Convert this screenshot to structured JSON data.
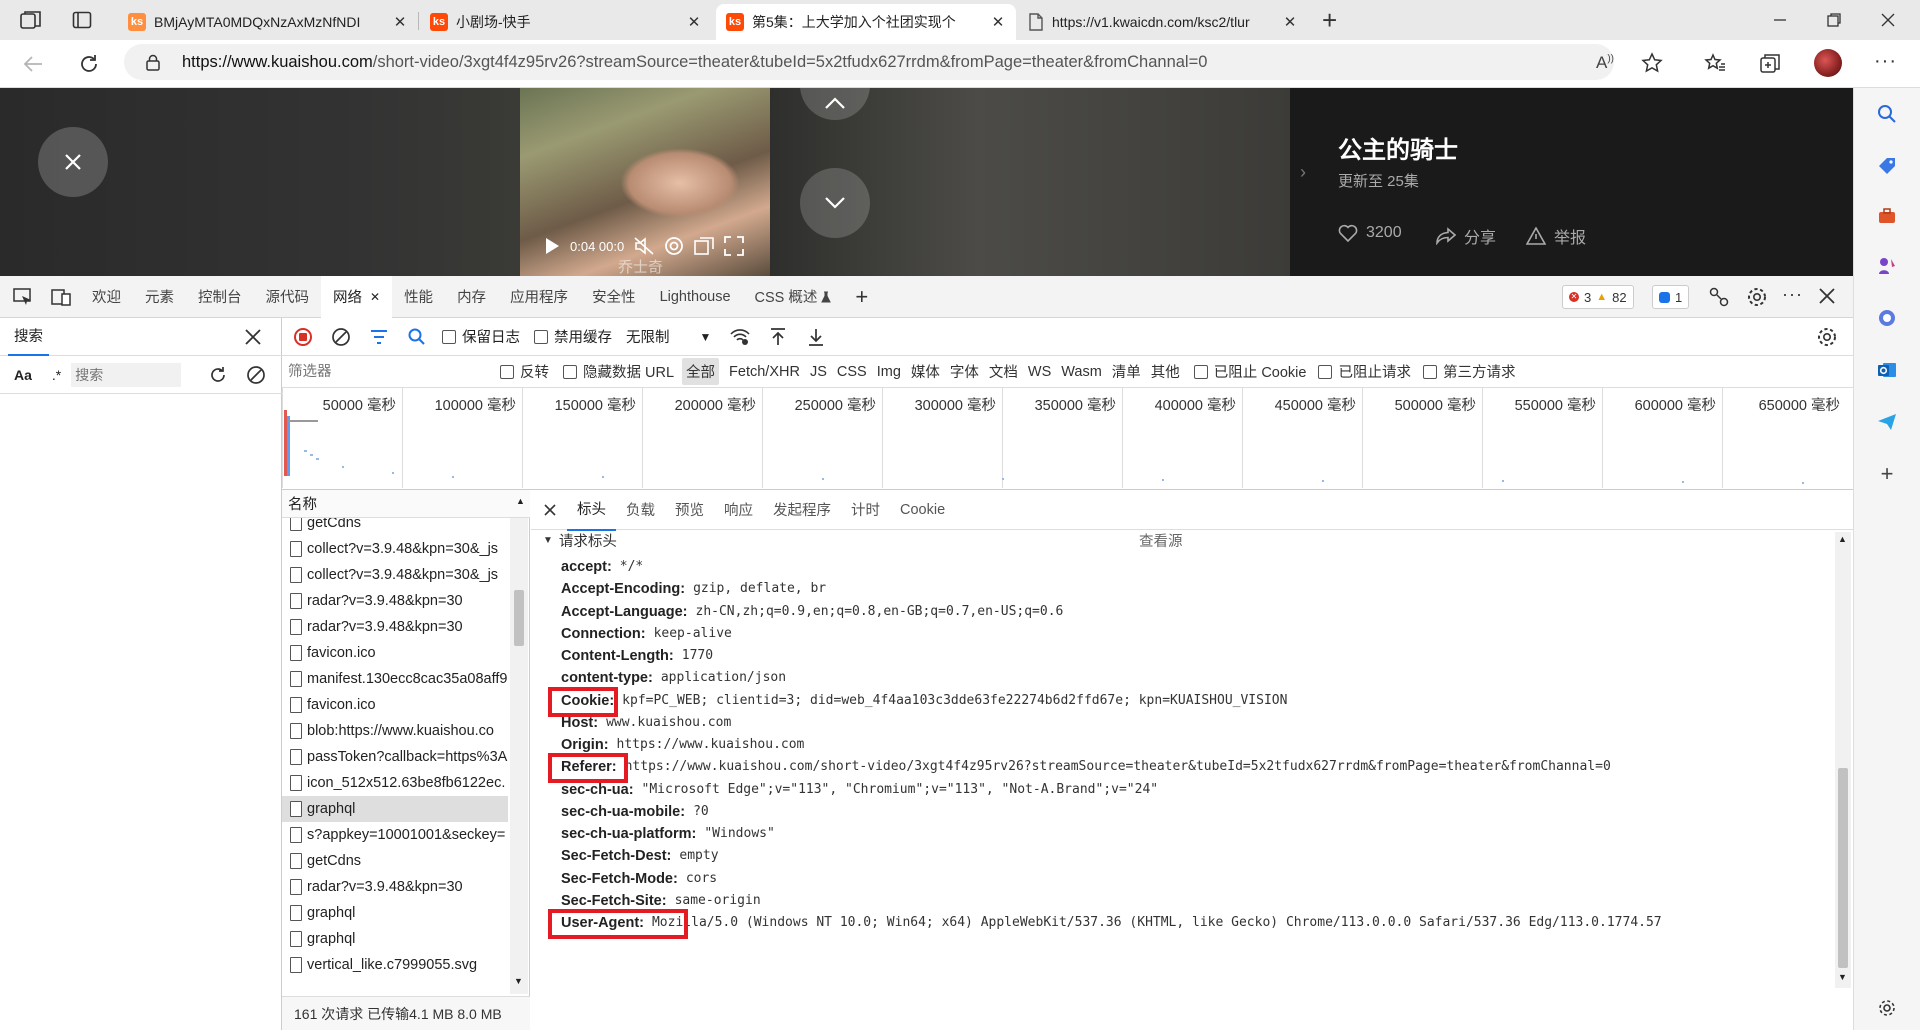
{
  "browser": {
    "tabs": [
      {
        "title": "BMjAyMTA0MDQxNzAxMzNfNDI",
        "icon": "kuaishou-favicon",
        "color": "#ff8f3f"
      },
      {
        "title": "小剧场-快手",
        "icon": "kuaishou-favicon",
        "color": "#ff4906"
      },
      {
        "title": "第5集：上大学加入个社团实现个",
        "icon": "kuaishou-favicon",
        "color": "#ff4906"
      },
      {
        "title": "https://v1.kwaicdn.com/ksc2/tlur",
        "icon": "page-icon"
      }
    ],
    "url_host": "https://www.kuaishou.com",
    "url_path": "/short-video/3xgt4f4z95rv26?streamSource=theater&tubeId=5x2tfudx627rrdm&fromPage=theater&fromChannal=0"
  },
  "player": {
    "series_title": "公主的骑士",
    "episodes_label": "更新至 25集",
    "likes": "3200",
    "share_label": "分享",
    "report_label": "举报",
    "time": "0:04 00:0",
    "caption": "乔士奇"
  },
  "devtools": {
    "tabs": [
      "欢迎",
      "元素",
      "控制台",
      "源代码",
      "网络",
      "性能",
      "内存",
      "应用程序",
      "安全性",
      "Lighthouse",
      "CSS 概述"
    ],
    "active_tab": "网络",
    "errors": "3",
    "warnings": "82",
    "messages": "1",
    "search": {
      "title": "搜索",
      "case_label": "Aa",
      "regex_label": ".*",
      "placeholder": "搜索"
    },
    "toolbar": {
      "preserve_log": "保留日志",
      "disable_cache": "禁用缓存",
      "throttle": "无限制"
    },
    "filter": {
      "placeholder": "筛选器",
      "invert": "反转",
      "hide_data_urls": "隐藏数据 URL",
      "types": [
        "全部",
        "Fetch/XHR",
        "JS",
        "CSS",
        "Img",
        "媒体",
        "字体",
        "文档",
        "WS",
        "Wasm",
        "清单",
        "其他"
      ],
      "blocked_cookies": "已阻止 Cookie",
      "blocked_requests": "已阻止请求",
      "third_party": "第三方请求"
    },
    "timeline_ticks": [
      "50000 毫秒",
      "100000 毫秒",
      "150000 毫秒",
      "200000 毫秒",
      "250000 毫秒",
      "300000 毫秒",
      "350000 毫秒",
      "400000 毫秒",
      "450000 毫秒",
      "500000 毫秒",
      "550000 毫秒",
      "600000 毫秒",
      "650000 毫秒"
    ],
    "request_list": {
      "header": "名称",
      "items": [
        "getCdns",
        "collect?v=3.9.48&kpn=30&_js",
        "collect?v=3.9.48&kpn=30&_js",
        "radar?v=3.9.48&kpn=30",
        "radar?v=3.9.48&kpn=30",
        "favicon.ico",
        "manifest.130ecc8cac35a08aff9",
        "favicon.ico",
        "blob:https://www.kuaishou.co",
        "passToken?callback=https%3A",
        "icon_512x512.63be8fb6122ec.",
        "graphql",
        "s?appkey=10001001&seckey=",
        "getCdns",
        "radar?v=3.9.48&kpn=30",
        "graphql",
        "graphql",
        "vertical_like.c7999055.svg"
      ],
      "selected_index": 11,
      "status": "161 次请求  已传输4.1 MB  8.0 MB"
    },
    "detail_tabs": [
      "标头",
      "负载",
      "预览",
      "响应",
      "发起程序",
      "计时",
      "Cookie"
    ],
    "section_title": "请求标头",
    "view_source": "查看源",
    "headers": [
      {
        "name": "accept:",
        "value": "*/*"
      },
      {
        "name": "Accept-Encoding:",
        "value": "gzip, deflate, br"
      },
      {
        "name": "Accept-Language:",
        "value": "zh-CN,zh;q=0.9,en;q=0.8,en-GB;q=0.7,en-US;q=0.6"
      },
      {
        "name": "Connection:",
        "value": "keep-alive"
      },
      {
        "name": "Content-Length:",
        "value": "1770"
      },
      {
        "name": "content-type:",
        "value": "application/json"
      },
      {
        "name": "Cookie:",
        "value": "kpf=PC_WEB; clientid=3; did=web_4f4aa103c3dde63fe22274b6d2ffd67e; kpn=KUAISHOU_VISION"
      },
      {
        "name": "Host:",
        "value": "www.kuaishou.com"
      },
      {
        "name": "Origin:",
        "value": "https://www.kuaishou.com"
      },
      {
        "name": "Referer:",
        "value": "https://www.kuaishou.com/short-video/3xgt4f4z95rv26?streamSource=theater&tubeId=5x2tfudx627rrdm&fromPage=theater&fromChannal=0"
      },
      {
        "name": "sec-ch-ua:",
        "value": "\"Microsoft Edge\";v=\"113\", \"Chromium\";v=\"113\", \"Not-A.Brand\";v=\"24\""
      },
      {
        "name": "sec-ch-ua-mobile:",
        "value": "?0"
      },
      {
        "name": "sec-ch-ua-platform:",
        "value": "\"Windows\""
      },
      {
        "name": "Sec-Fetch-Dest:",
        "value": "empty"
      },
      {
        "name": "Sec-Fetch-Mode:",
        "value": "cors"
      },
      {
        "name": "Sec-Fetch-Site:",
        "value": "same-origin"
      },
      {
        "name": "User-Agent:",
        "value": "Mozilla/5.0 (Windows NT 10.0; Win64; x64) AppleWebKit/537.36 (KHTML, like Gecko) Chrome/113.0.0.0 Safari/537.36 Edg/113.0.1774.57"
      }
    ],
    "highlighted_headers": [
      "Cookie:",
      "Referer:",
      "User-Agent:"
    ],
    "highlight_color": "#e41b23"
  }
}
